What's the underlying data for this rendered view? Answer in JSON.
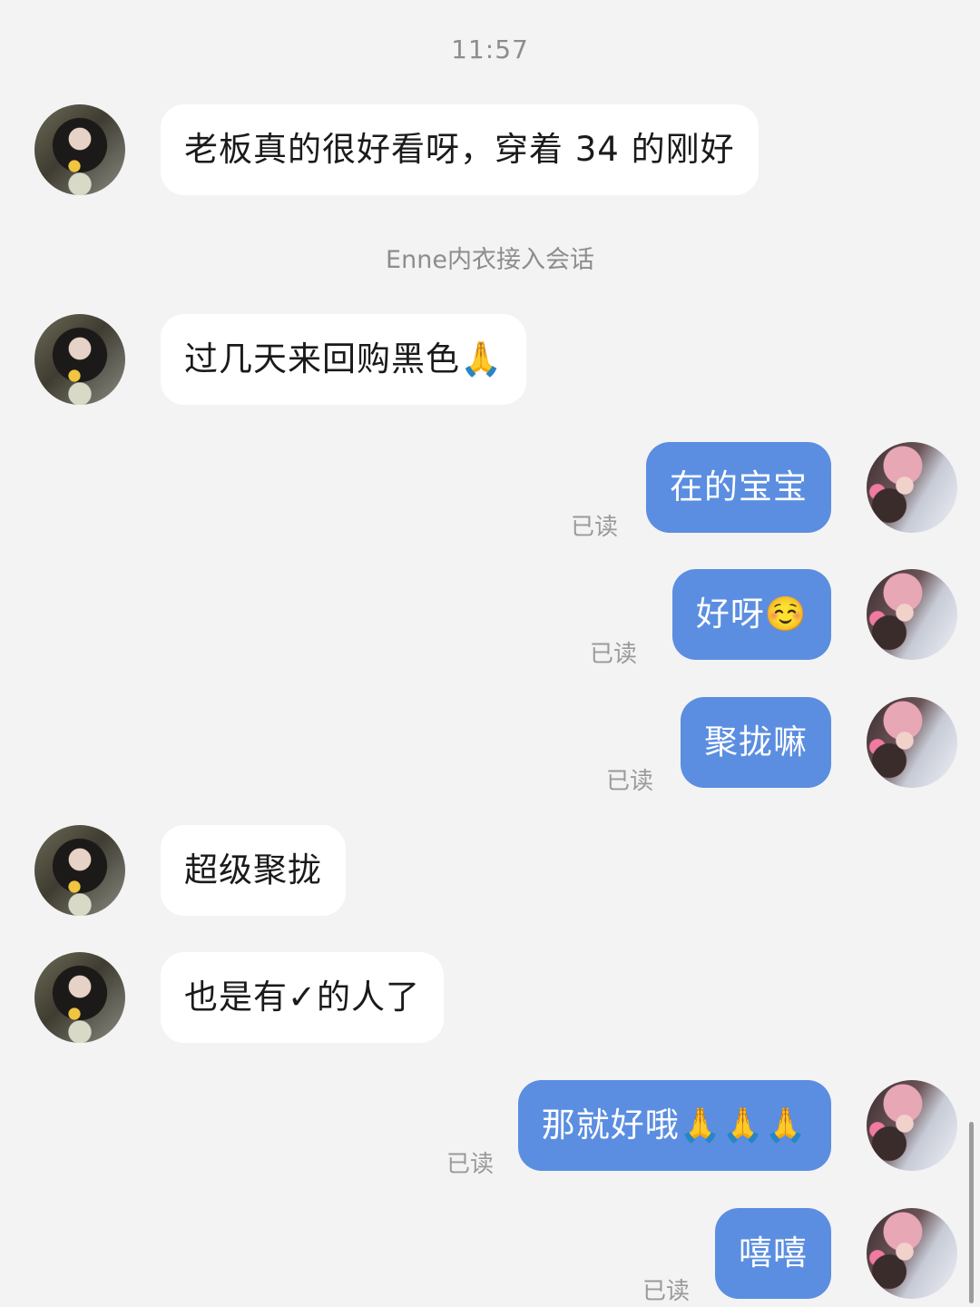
{
  "chat": {
    "timestamp": "11:57",
    "system_note": "Enne内衣接入会话",
    "messages": [
      {
        "sender": "customer",
        "text": "老板真的很好看呀，穿着 34 的刚好"
      },
      {
        "sender": "customer",
        "text": "过几天来回购黑色🙏"
      },
      {
        "sender": "shop",
        "text": "在的宝宝",
        "status": "已读"
      },
      {
        "sender": "shop",
        "text": "好呀☺️",
        "status": "已读"
      },
      {
        "sender": "shop",
        "text": "聚拢嘛",
        "status": "已读"
      },
      {
        "sender": "customer",
        "text": "超级聚拢"
      },
      {
        "sender": "customer",
        "text": "也是有✓的人了"
      },
      {
        "sender": "shop",
        "text": "那就好哦🙏🙏🙏",
        "status": "已读"
      },
      {
        "sender": "shop",
        "text": "嘻嘻",
        "status": "已读"
      }
    ]
  },
  "colors": {
    "background": "#f3f3f3",
    "incoming_bubble": "#ffffff",
    "outgoing_bubble": "#5b8ee0",
    "meta_text": "#8d8d8d"
  },
  "icons": {
    "customer_avatar": "avatar-customer",
    "shop_avatar": "avatar-shop"
  }
}
